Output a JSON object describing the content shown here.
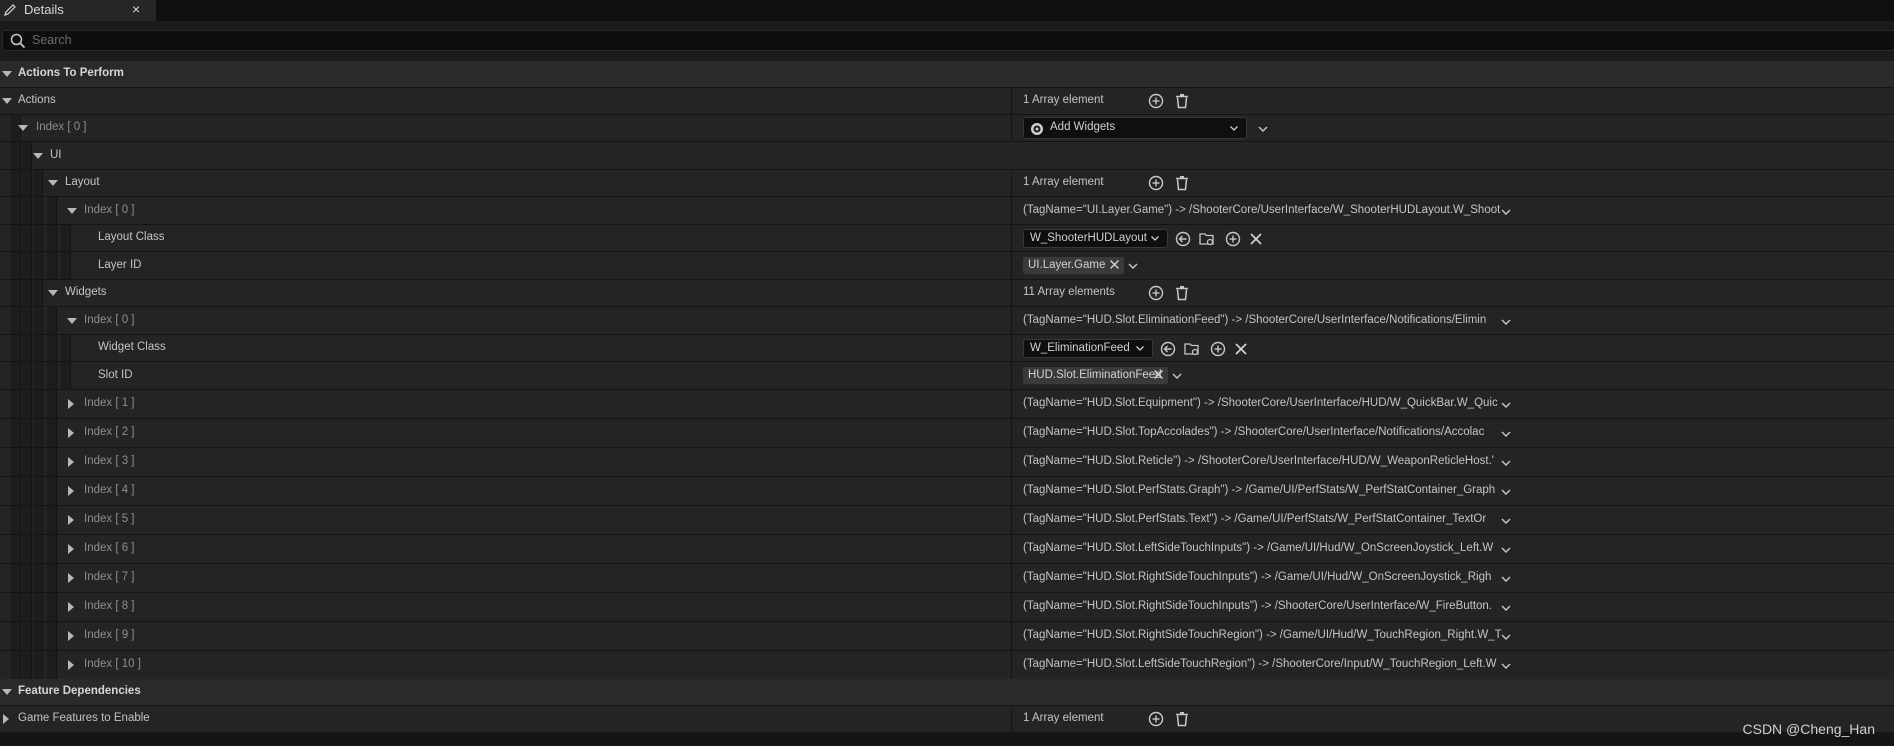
{
  "tab": {
    "title": "Details",
    "close": "×",
    "icon": "pencil-icon"
  },
  "search": {
    "placeholder": "Search"
  },
  "actions_category": {
    "label": "Actions To Perform"
  },
  "actions": {
    "label": "Actions",
    "count": "1 Array element"
  },
  "action0": {
    "label": "Index [ 0 ]",
    "type_value": "Add Widgets"
  },
  "ui": {
    "label": "UI"
  },
  "layout": {
    "label": "Layout",
    "count": "1 Array element"
  },
  "layout0": {
    "label": "Index [ 0 ]",
    "summary": "(TagName=\"UI.Layer.Game\") -> /ShooterCore/UserInterface/W_ShooterHUDLayout.W_Shoot",
    "class_label": "Layout Class",
    "class_value": "W_ShooterHUDLayout",
    "layer_label": "Layer ID",
    "layer_value": "UI.Layer.Game"
  },
  "widgets": {
    "label": "Widgets",
    "count": "11 Array elements"
  },
  "widget0": {
    "label": "Index [ 0 ]",
    "summary": "(TagName=\"HUD.Slot.EliminationFeed\") -> /ShooterCore/UserInterface/Notifications/Elimin",
    "class_label": "Widget Class",
    "class_value": "W_EliminationFeed",
    "slot_label": "Slot ID",
    "slot_value": "HUD.Slot.EliminationFeed"
  },
  "widget_items": [
    {
      "label": "Index [ 1 ]",
      "summary": "(TagName=\"HUD.Slot.Equipment\") -> /ShooterCore/UserInterface/HUD/W_QuickBar.W_Quic"
    },
    {
      "label": "Index [ 2 ]",
      "summary": "(TagName=\"HUD.Slot.TopAccolades\") -> /ShooterCore/UserInterface/Notifications/Accolac"
    },
    {
      "label": "Index [ 3 ]",
      "summary": "(TagName=\"HUD.Slot.Reticle\") -> /ShooterCore/UserInterface/HUD/W_WeaponReticleHost.'"
    },
    {
      "label": "Index [ 4 ]",
      "summary": "(TagName=\"HUD.Slot.PerfStats.Graph\") -> /Game/UI/PerfStats/W_PerfStatContainer_Graph"
    },
    {
      "label": "Index [ 5 ]",
      "summary": "(TagName=\"HUD.Slot.PerfStats.Text\") -> /Game/UI/PerfStats/W_PerfStatContainer_TextOr"
    },
    {
      "label": "Index [ 6 ]",
      "summary": "(TagName=\"HUD.Slot.LeftSideTouchInputs\") -> /Game/UI/Hud/W_OnScreenJoystick_Left.W"
    },
    {
      "label": "Index [ 7 ]",
      "summary": "(TagName=\"HUD.Slot.RightSideTouchInputs\") -> /Game/UI/Hud/W_OnScreenJoystick_Righ"
    },
    {
      "label": "Index [ 8 ]",
      "summary": "(TagName=\"HUD.Slot.RightSideTouchInputs\") -> /ShooterCore/UserInterface/W_FireButton."
    },
    {
      "label": "Index [ 9 ]",
      "summary": "(TagName=\"HUD.Slot.RightSideTouchRegion\") -> /Game/UI/Hud/W_TouchRegion_Right.W_T"
    },
    {
      "label": "Index [ 10 ]",
      "summary": "(TagName=\"HUD.Slot.LeftSideTouchRegion\") -> /ShooterCore/Input/W_TouchRegion_Left.W"
    }
  ],
  "feature_category": {
    "label": "Feature Dependencies"
  },
  "game_features": {
    "label": "Game Features to Enable",
    "count": "1 Array element"
  },
  "watermark": "CSDN @Cheng_Han",
  "colors": {
    "background": "#151515",
    "row": "#242424",
    "category": "#2a2a2a",
    "text": "#c4c4c4",
    "tag": "#3a3a3a"
  }
}
